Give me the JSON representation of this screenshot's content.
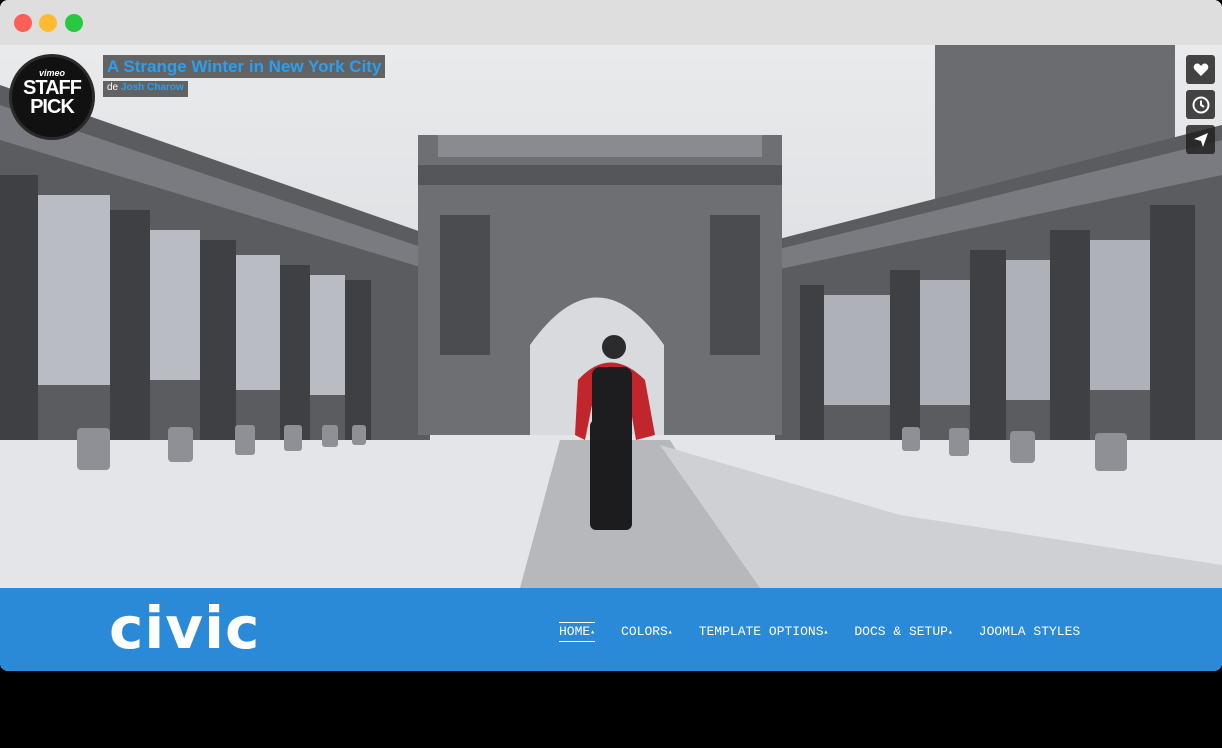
{
  "video": {
    "title": "A Strange Winter in New York City",
    "byline_prefix": "de",
    "author": "Josh Charow",
    "badge": {
      "brand": "vimeo",
      "line1": "STAFF",
      "line2": "PICK"
    },
    "actions": [
      {
        "icon": "heart-icon"
      },
      {
        "icon": "clock-icon"
      },
      {
        "icon": "send-icon"
      }
    ]
  },
  "site": {
    "logo": "civic",
    "brand_color": "#2a8ad8",
    "menu": [
      {
        "label": "HOME",
        "caret": "▴",
        "active": true
      },
      {
        "label": "COLORS",
        "caret": "▴"
      },
      {
        "label": "TEMPLATE OPTIONS",
        "caret": "▴"
      },
      {
        "label": "DOCS & SETUP",
        "caret": "▴"
      },
      {
        "label": "JOOMLA STYLES",
        "caret": ""
      }
    ]
  }
}
